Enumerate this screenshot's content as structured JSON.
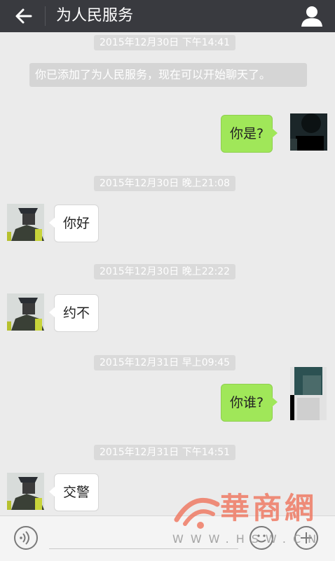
{
  "header": {
    "title": "为人民服务",
    "back_icon": "arrow-left-icon",
    "profile_icon": "person-icon"
  },
  "messages": {
    "ts1": "2015年12月30日 下午14:41",
    "system": "你已添加了为人民服务，现在可以开始聊天了。",
    "m1": "你是?",
    "ts2": "2015年12月30日 晚上21:08",
    "m2": "你好",
    "ts3": "2015年12月30日 晚上22:22",
    "m3": "约不",
    "ts4": "2015年12月31日 早上09:45",
    "m4": "你谁?",
    "ts5": "2015年12月31日 下午14:51",
    "m5": "交警"
  },
  "watermark": {
    "name": "華商網",
    "url": "WWW.HSW.CN"
  },
  "colors": {
    "topbar": "#393a3f",
    "sent_bubble": "#a0e759",
    "received_bubble": "#ffffff",
    "background": "#ebebeb"
  }
}
